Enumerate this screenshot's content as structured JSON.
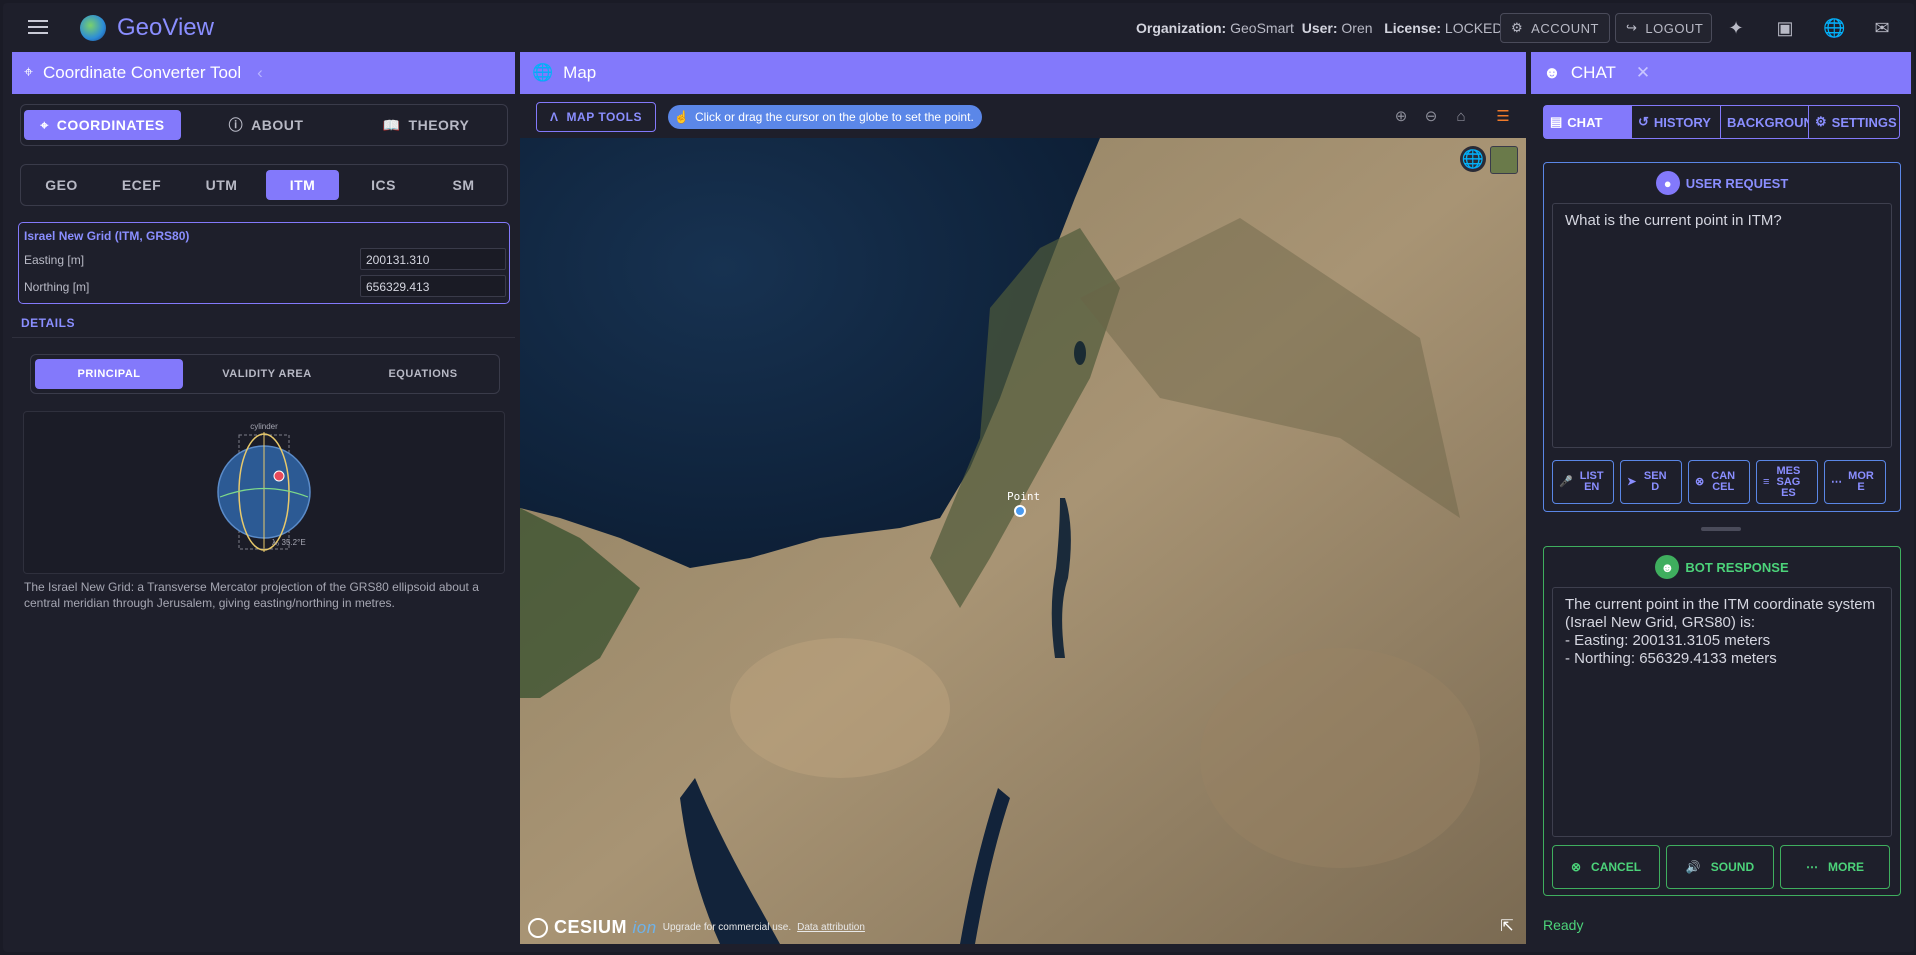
{
  "topbar": {
    "app_title": "GeoView",
    "org_label": "Organization:",
    "org_value": "GeoSmart",
    "user_label": "User:",
    "user_value": "Oren",
    "license_label": "License:",
    "license_value": "LOCKED",
    "account_label": "ACCOUNT",
    "logout_label": "LOGOUT"
  },
  "left": {
    "header": "Coordinate Converter Tool",
    "main_tabs": [
      "COORDINATES",
      "ABOUT",
      "THEORY"
    ],
    "system_tabs": [
      "GEO",
      "ECEF",
      "UTM",
      "ITM",
      "ICS",
      "SM"
    ],
    "itm": {
      "title": "Israel New Grid (ITM, GRS80)",
      "easting_label": "Easting [m]",
      "easting_value": "200131.310",
      "northing_label": "Northing [m]",
      "northing_value": "656329.413"
    },
    "details_label": "DETAILS",
    "detail_tabs": [
      "PRINCIPAL",
      "VALIDITY AREA",
      "EQUATIONS"
    ],
    "diagram": {
      "top_label": "cylinder",
      "bottom_label": "λ₀ 35.2°E"
    },
    "description": "The Israel New Grid: a Transverse Mercator projection of the GRS80 ellipsoid about a central meridian through Jerusalem, giving easting/northing in metres."
  },
  "map": {
    "header": "Map",
    "tools_label": "MAP TOOLS",
    "hint": "Click or drag the cursor on the globe to set the point.",
    "point_label": "Point",
    "cesium_brand": "CESIUM",
    "cesium_ion": "ion",
    "upgrade_text": "Upgrade for commercial use.",
    "attribution_text": "Data attribution"
  },
  "chat": {
    "header": "CHAT",
    "tabs": [
      "CHAT",
      "HISTORY",
      "BACKGROUND",
      "SETTINGS"
    ],
    "request_title": "USER REQUEST",
    "request_text": "What is the current point in ITM?",
    "request_buttons": [
      {
        "l1": "LIST",
        "l2": "EN",
        "l3": ""
      },
      {
        "l1": "SEN",
        "l2": "D",
        "l3": ""
      },
      {
        "l1": "CAN",
        "l2": "CEL",
        "l3": ""
      },
      {
        "l1": "MES",
        "l2": "SAG",
        "l3": "ES"
      },
      {
        "l1": "MOR",
        "l2": "E",
        "l3": ""
      }
    ],
    "response_title": "BOT RESPONSE",
    "response_text": "The current point in the ITM coordinate system (Israel New Grid, GRS80) is:\n- Easting: 200131.3105 meters\n- Northing: 656329.4133 meters",
    "response_buttons": [
      "CANCEL",
      "SOUND",
      "MORE"
    ],
    "status": "Ready",
    "colors": {
      "accent": "#8379fb",
      "blue": "#5a86e6",
      "green": "#3fae5e"
    }
  }
}
